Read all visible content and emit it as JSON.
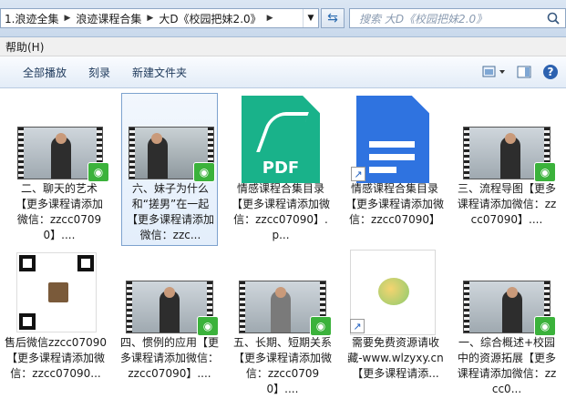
{
  "address": {
    "crumbs": [
      "1.浪迹全集",
      "浪迹课程合集",
      "大D《校园把妹2.0》"
    ]
  },
  "search": {
    "placeholder": "搜索 大D《校园把妹2.0》"
  },
  "menu": {
    "items": [
      "帮助(H)"
    ]
  },
  "toolbar": {
    "play_all": "全部播放",
    "burn": "刻录",
    "new_folder": "新建文件夹"
  },
  "files": [
    {
      "type": "video",
      "label": "二、聊天的艺术【更多课程请添加微信：zzcc07090】...."
    },
    {
      "type": "video",
      "label": "六、妹子为什么和“搓男”在一起【更多课程请添加微信：zzc...",
      "selected": true
    },
    {
      "type": "pdf",
      "label": "情感课程合集目录【更多课程请添加微信：zzcc07090】.p...",
      "icon_text": "PDF"
    },
    {
      "type": "doc",
      "label": "情感课程合集目录【更多课程请添加微信：zzcc07090】"
    },
    {
      "type": "video",
      "label": "三、流程导图【更多课程请添加微信：zzcc07090】...."
    },
    {
      "type": "qr",
      "label": "售后微信zzcc07090【更多课程请添加微信：zzcc07090..."
    },
    {
      "type": "video",
      "label": "四、惯例的应用【更多课程请添加微信：zzcc07090】...."
    },
    {
      "type": "video",
      "label": "五、长期、短期关系【更多课程请添加微信：zzcc07090】...."
    },
    {
      "type": "web",
      "label": "需要免费资源请收藏-www.wlzyxy.cn【更多课程请添..."
    },
    {
      "type": "video",
      "label": "一、综合概述+校园中的资源拓展【更多课程请添加微信：zzcc0..."
    }
  ],
  "colors": {
    "accent": "#2b6cb0",
    "badge": "#3bb23b",
    "pdf": "#19b28a",
    "doc": "#2f73e0"
  }
}
